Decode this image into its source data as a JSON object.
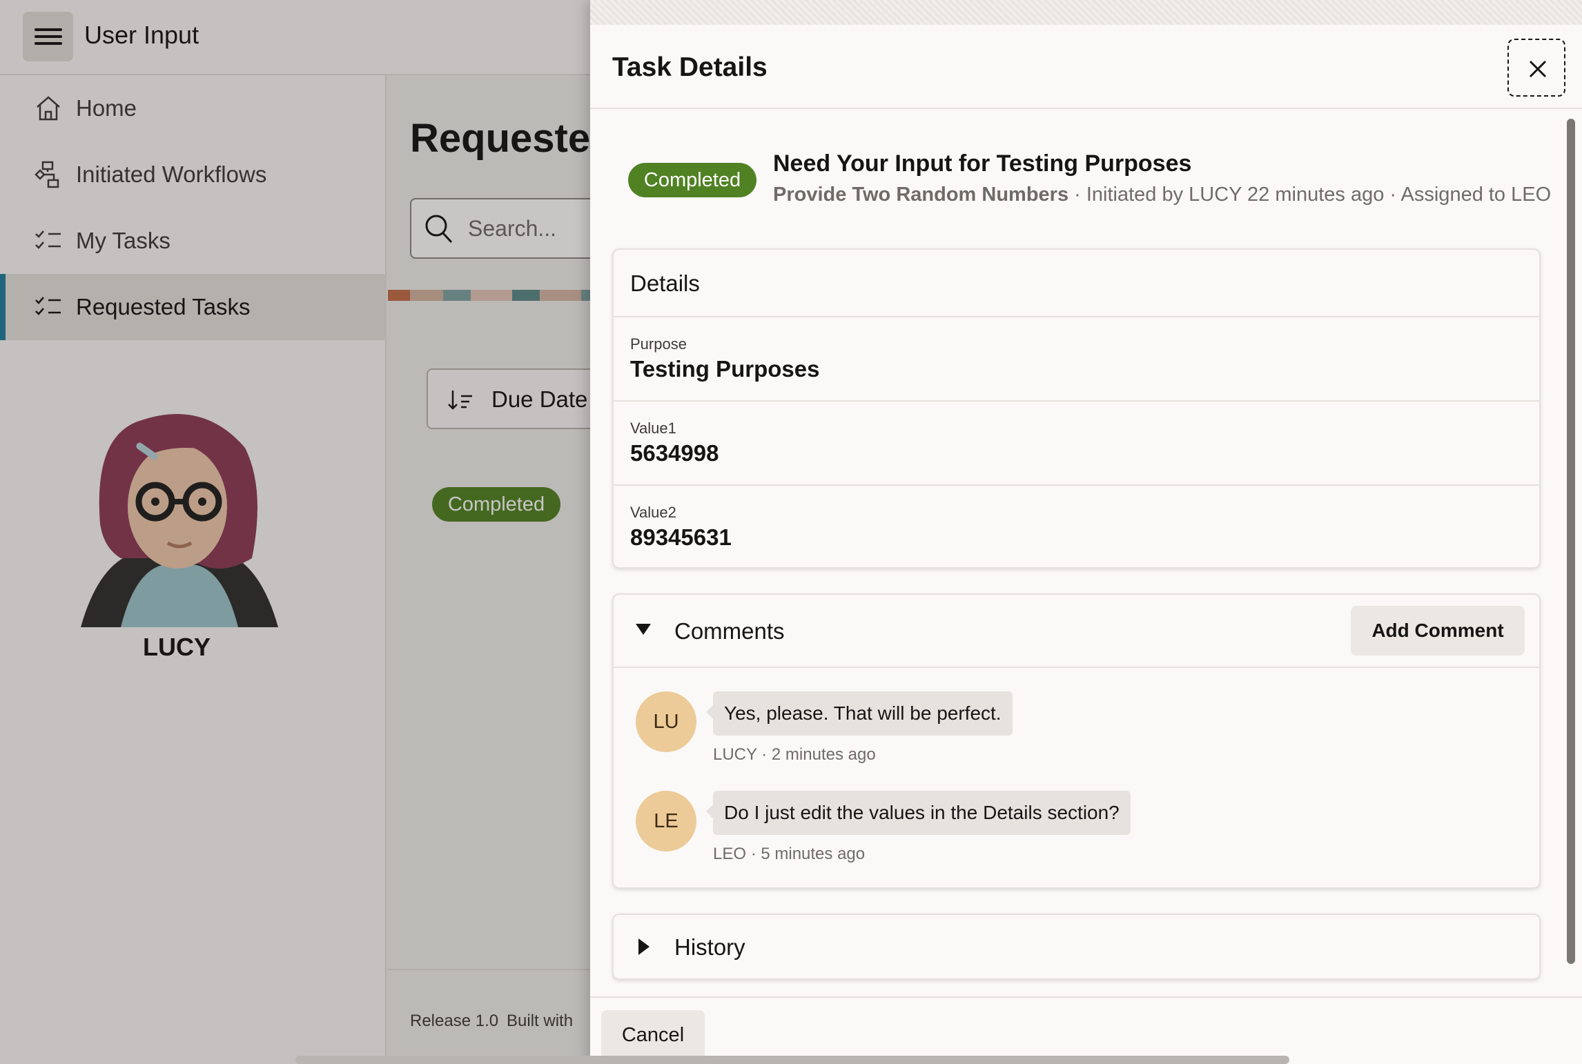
{
  "app": {
    "title": "User Input",
    "nav": [
      {
        "label": "Home",
        "icon": "home-icon"
      },
      {
        "label": "Initiated Workflows",
        "icon": "workflow-icon"
      },
      {
        "label": "My Tasks",
        "icon": "task-list-icon"
      },
      {
        "label": "Requested Tasks",
        "icon": "task-list-icon",
        "active": true
      }
    ],
    "user_name": "LUCY",
    "page_heading": "Requested Tasks",
    "search_placeholder": "Search...",
    "sort_label": "Due Date",
    "row_status": "Completed",
    "footer": {
      "release": "Release 1.0",
      "built_with": "Built with"
    }
  },
  "drawer": {
    "title": "Task Details",
    "task": {
      "status": "Completed",
      "title": "Need Your Input for Testing Purposes",
      "workflow": "Provide Two Random Numbers",
      "meta": " · Initiated by LUCY 22 minutes ago · Assigned to LEO"
    },
    "details": {
      "title": "Details",
      "fields": [
        {
          "label": "Purpose",
          "value": "Testing Purposes"
        },
        {
          "label": "Value1",
          "value": "5634998"
        },
        {
          "label": "Value2",
          "value": "89345631"
        }
      ]
    },
    "comments": {
      "title": "Comments",
      "add_label": "Add Comment",
      "items": [
        {
          "initials": "LU",
          "text": "Yes, please. That will be perfect.",
          "meta": "LUCY · 2 minutes ago"
        },
        {
          "initials": "LE",
          "text": "Do I just edit the values in the Details section?",
          "meta": "LEO · 5 minutes ago"
        }
      ]
    },
    "history": {
      "title": "History"
    },
    "cancel_label": "Cancel"
  },
  "colors": {
    "status_completed": "#508223",
    "nav_accent": "#227e9e",
    "comment_avatar": "#eccb98"
  }
}
